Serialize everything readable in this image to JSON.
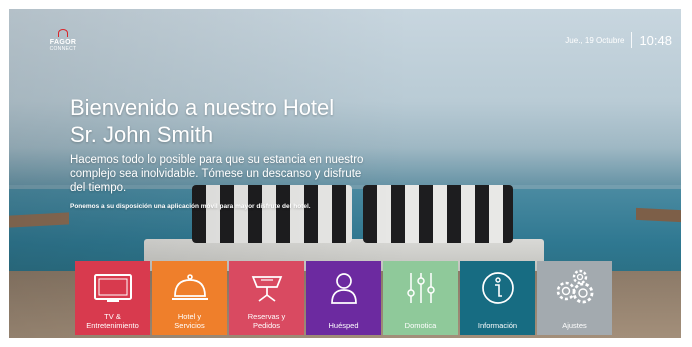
{
  "brand": {
    "name": "FAGOR",
    "sub": "CONNECT"
  },
  "status": {
    "date": "Jue., 19 Octubre",
    "time": "10:48"
  },
  "welcome": {
    "line1": "Bienvenido a nuestro Hotel",
    "line2": "Sr. John Smith",
    "desc1": "Hacemos todo lo posible para que su estancia en nuestro",
    "desc2": "complejo sea inolvidable. Tómese un descanso y disfrute",
    "desc3": "del tiempo.",
    "note": "Ponemos a su disposición una aplicación móvil para mayor disfrute del hotel."
  },
  "tiles": [
    {
      "line1": "TV &",
      "line2": "Entretenimiento",
      "icon": "tv-icon",
      "color": "#d83a4e"
    },
    {
      "line1": "Hotel y",
      "line2": "Servicios",
      "icon": "service-bell-icon",
      "color": "#ef7f2b"
    },
    {
      "line1": "Reservas y",
      "line2": "Pedidos",
      "icon": "room-service-icon",
      "color": "#d94a61"
    },
    {
      "line1": "Huésped",
      "line2": "",
      "icon": "user-icon",
      "color": "#6c2aa0"
    },
    {
      "line1": "Domotica",
      "line2": "",
      "icon": "sliders-icon",
      "color": "#8fc99a"
    },
    {
      "line1": "Información",
      "line2": "",
      "icon": "info-icon",
      "color": "#176c82"
    },
    {
      "line1": "Ajustes",
      "line2": "",
      "icon": "gears-icon",
      "color": "#a3aaaf"
    }
  ]
}
